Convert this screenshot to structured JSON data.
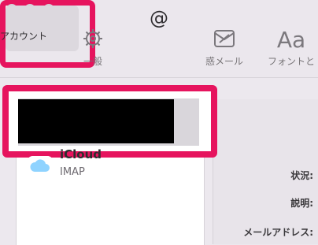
{
  "window": {
    "traffic_lights": [
      "close",
      "minimize",
      "zoom"
    ]
  },
  "toolbar": {
    "tabs": [
      {
        "id": "general",
        "label": "一般",
        "icon": "gear-icon"
      },
      {
        "id": "accounts",
        "label": "アカウント",
        "icon": "at-sign-icon",
        "selected": true
      },
      {
        "id": "junk",
        "label": "迷惑メール",
        "visible_label": "惑メール",
        "icon": "junk-mail-icon"
      },
      {
        "id": "fonts",
        "label": "フォントと",
        "icon": "font-icon"
      }
    ]
  },
  "accounts_list": {
    "selected_account_redacted": true,
    "items": [
      {
        "name": "iCloud",
        "visible_name": "iCloud",
        "type": "IMAP"
      }
    ]
  },
  "account_details": {
    "labels": {
      "status": "状況:",
      "description": "説明:",
      "email": "メールアドレス:"
    }
  },
  "colors": {
    "highlight": "#e6145e",
    "background": "#ece8ee",
    "panel_white": "#ffffff",
    "text_dark": "#2f2d30"
  }
}
